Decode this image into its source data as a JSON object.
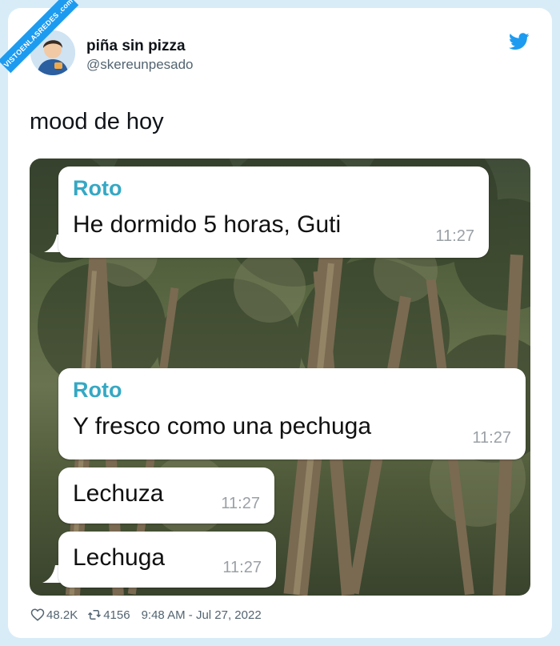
{
  "watermark": "VISTOENLASREDES .com",
  "author": {
    "display_name": "piña sin pizza",
    "handle": "@skereunpesado"
  },
  "tweet": {
    "text": "mood de hoy"
  },
  "chat": {
    "messages": [
      {
        "sender": "Roto",
        "text": "He dormido 5 horas, Guti",
        "time": "11:27"
      },
      {
        "sender": "Roto",
        "text": "Y fresco como una pechuga",
        "time": "11:27"
      },
      {
        "sender": "",
        "text": "Lechuza",
        "time": "11:27"
      },
      {
        "sender": "",
        "text": "Lechuga",
        "time": "11:27"
      }
    ]
  },
  "stats": {
    "likes": "48.2K",
    "retweets": "4156",
    "timestamp": "9:48 AM - Jul 27, 2022"
  },
  "colors": {
    "twitter_blue": "#1d9bf0",
    "sender_name": "#35a8c4",
    "page_background": "#d8ecf8"
  },
  "icons": [
    "twitter-bird-icon",
    "heart-icon",
    "retweet-icon"
  ]
}
